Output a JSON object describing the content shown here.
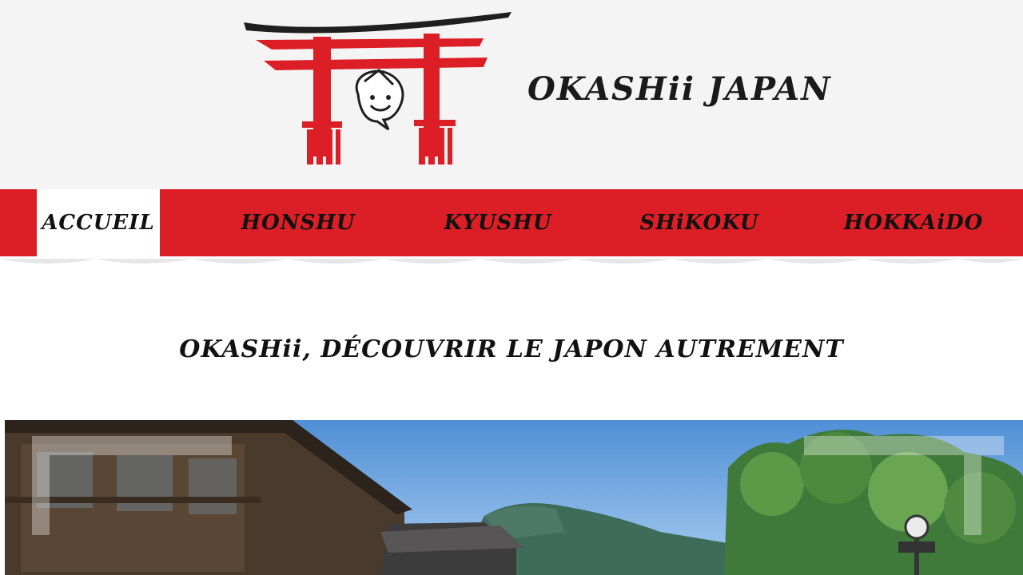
{
  "site": {
    "brand_name": "OKASHii JAPAN"
  },
  "nav": {
    "items": [
      {
        "label": "ACCUEIL",
        "active": true
      },
      {
        "label": "HONSHU",
        "active": false
      },
      {
        "label": "KYUSHU",
        "active": false
      },
      {
        "label": "SHiKOKU",
        "active": false
      },
      {
        "label": "HOKKAiDO",
        "active": false
      }
    ]
  },
  "main": {
    "tagline": "OKASHii, DÉCOUVRIR LE JAPON AUTREMENT"
  },
  "colors": {
    "nav_background": "#dc1f26",
    "header_background": "#f4f4f4",
    "torii_red": "#dc1f26",
    "torii_black": "#1f1f1f"
  },
  "icons": {
    "logo": "torii-gate-with-mascot-icon"
  }
}
